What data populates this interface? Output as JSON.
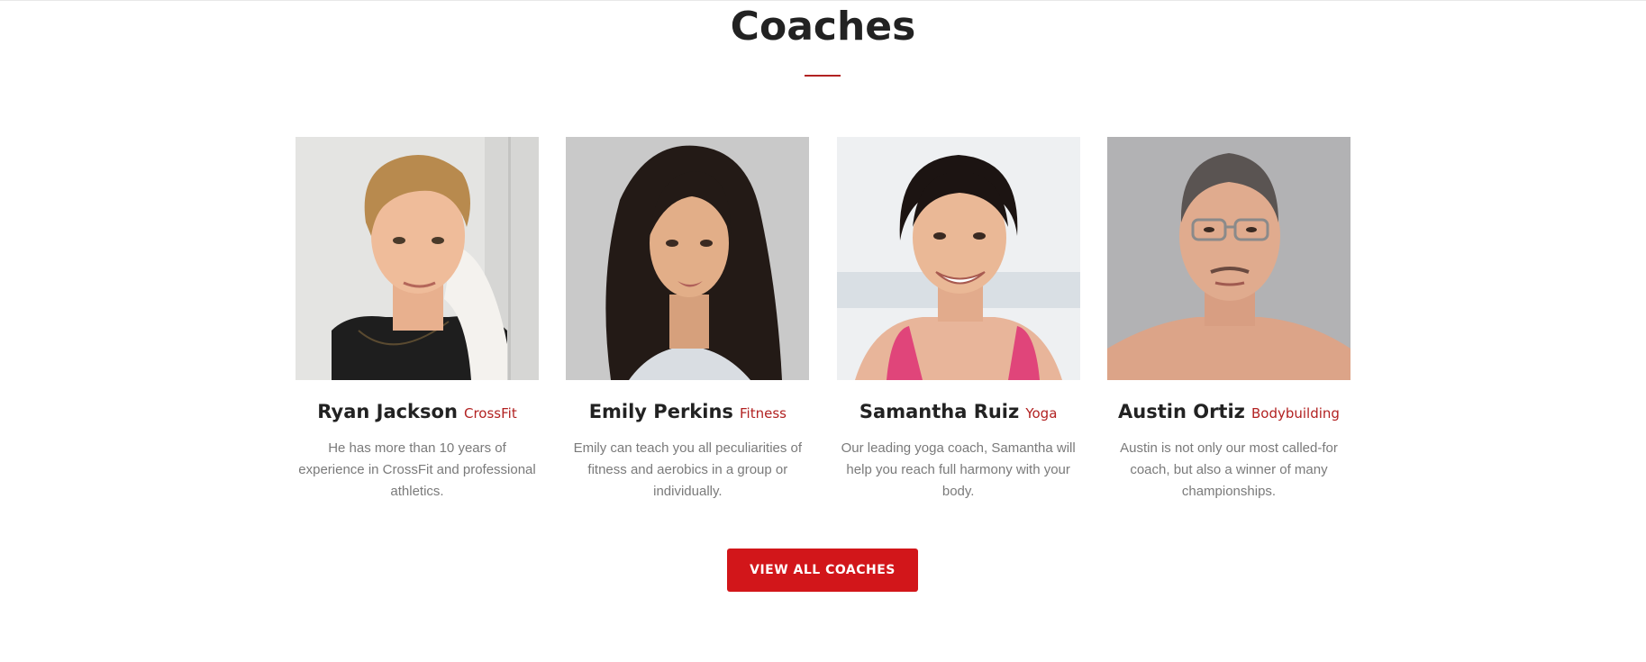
{
  "section": {
    "title": "Coaches",
    "accent_color": "#b22222"
  },
  "coaches": [
    {
      "name": "Ryan Jackson",
      "specialty": "CrossFit",
      "bio": "He has more than 10 years of experience in CrossFit and professional athletics."
    },
    {
      "name": "Emily Perkins",
      "specialty": "Fitness",
      "bio": "Emily can teach you all peculiarities of fitness and aerobics in a group or individually."
    },
    {
      "name": "Samantha Ruiz",
      "specialty": "Yoga",
      "bio": "Our leading yoga coach, Samantha will help you reach full harmony with your body."
    },
    {
      "name": "Austin Ortiz",
      "specialty": "Bodybuilding",
      "bio": "Austin is not only our most called-for coach, but also a winner of many championships."
    }
  ],
  "cta": {
    "label": "VIEW ALL COACHES",
    "color": "#d2161a"
  }
}
